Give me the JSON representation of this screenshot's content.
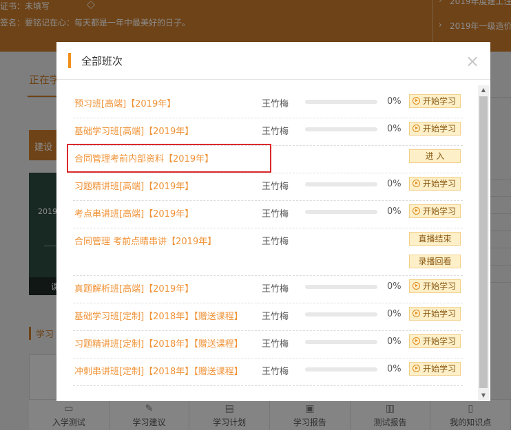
{
  "background": {
    "cert_label": "证书：未填写",
    "signature": "签名：要铭记在心：每天都是一年中最美好的日子。",
    "news": [
      "2019年度建工注",
      "2019年一级造价工"
    ],
    "active_tab": "正在学",
    "section_label": "建设",
    "course_year": "2019",
    "course_bottom": "课",
    "study_label": "学习",
    "nav": [
      {
        "icon": "monitor-icon",
        "label": "入学测试"
      },
      {
        "icon": "edit-icon",
        "label": "学习建议"
      },
      {
        "icon": "document-icon",
        "label": "学习计划"
      },
      {
        "icon": "chat-icon",
        "label": "学习报告"
      },
      {
        "icon": "chart-icon",
        "label": "测试报告"
      },
      {
        "icon": "book-icon",
        "label": "我的知识点"
      }
    ]
  },
  "modal": {
    "title": "全部班次",
    "close_glyph": "×",
    "courses": [
      {
        "name": "预习班[高端]【2019年】",
        "teacher": "王竹梅",
        "progress": 0,
        "progress_text": "0%",
        "actions": [
          "开始学习"
        ],
        "action_type": "start"
      },
      {
        "name": "基础学习班[高端]【2019年】",
        "teacher": "王竹梅",
        "progress": 0,
        "progress_text": "0%",
        "actions": [
          "开始学习"
        ],
        "action_type": "start"
      },
      {
        "name": "合同管理考前内部资料【2019年】",
        "teacher": "",
        "progress_text": "",
        "actions": [
          "进 入"
        ],
        "action_type": "enter"
      },
      {
        "name": "习题精讲班[高端]【2019年】",
        "teacher": "王竹梅",
        "progress": 0,
        "progress_text": "0%",
        "actions": [
          "开始学习"
        ],
        "action_type": "start"
      },
      {
        "name": "考点串讲班[高端]【2019年】",
        "teacher": "王竹梅",
        "progress": 0,
        "progress_text": "0%",
        "actions": [
          "开始学习"
        ],
        "action_type": "start"
      },
      {
        "name": "合同管理 考前点睛串讲【2019年】",
        "teacher": "王竹梅",
        "progress_text": "",
        "actions": [
          "直播结束",
          "录播回看"
        ],
        "action_type": "live"
      },
      {
        "name": "真题解析班[高端]【2019年】",
        "teacher": "王竹梅",
        "progress": 0,
        "progress_text": "0%",
        "actions": [
          "开始学习"
        ],
        "action_type": "start"
      },
      {
        "name": "基础学习班[定制]【2018年】【赠送课程】",
        "teacher": "王竹梅",
        "progress": 0,
        "progress_text": "0%",
        "actions": [
          "开始学习"
        ],
        "action_type": "start"
      },
      {
        "name": "习题精讲班[定制]【2018年】【赠送课程】",
        "teacher": "王竹梅",
        "progress": 0,
        "progress_text": "0%",
        "actions": [
          "开始学习"
        ],
        "action_type": "start"
      },
      {
        "name": "冲刺串讲班[定制]【2018年】【赠送课程】",
        "teacher": "王竹梅",
        "progress": 0,
        "progress_text": "0%",
        "actions": [
          "开始学习"
        ],
        "action_type": "start"
      }
    ]
  },
  "colors": {
    "accent": "#f18f1c",
    "course_link": "#f09236",
    "highlight_border": "#d9292b",
    "button_bg": "#fdefc8"
  }
}
